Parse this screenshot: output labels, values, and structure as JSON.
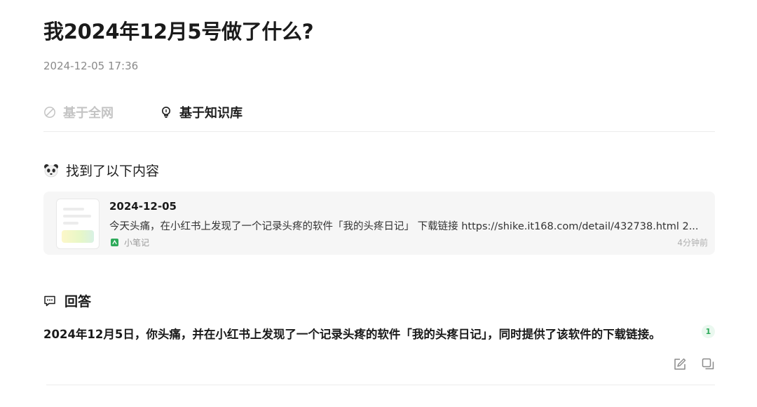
{
  "page": {
    "title": "我2024年12月5号做了什么?",
    "timestamp": "2024-12-05 17:36"
  },
  "tabs": [
    {
      "label": "基于全网",
      "icon": "web-search-icon",
      "active": false
    },
    {
      "label": "基于知识库",
      "icon": "lightbulb-icon",
      "active": true
    }
  ],
  "found": {
    "title": "找到了以下内容",
    "icon": "panda-icon"
  },
  "result": {
    "date": "2024-12-05",
    "snippet": "今天头痛，在小红书上发现了一个记录头疼的软件「我的头疼日记」 下载链接 https://shike.it168.com/detail/432738.html 2...",
    "source": "小笔记",
    "source_color": "#2eaa5a",
    "age": "4分钟前"
  },
  "answer": {
    "title": "回答",
    "icon": "message-icon",
    "text": "2024年12月5日，你头痛，并在小红书上发现了一个记录头疼的软件「我的头疼日记」，同时提供了该软件的下载链接。",
    "citation": "1",
    "citation_color": "#2eaa5a"
  },
  "actions": [
    {
      "name": "edit-icon"
    },
    {
      "name": "copy-icon"
    }
  ]
}
